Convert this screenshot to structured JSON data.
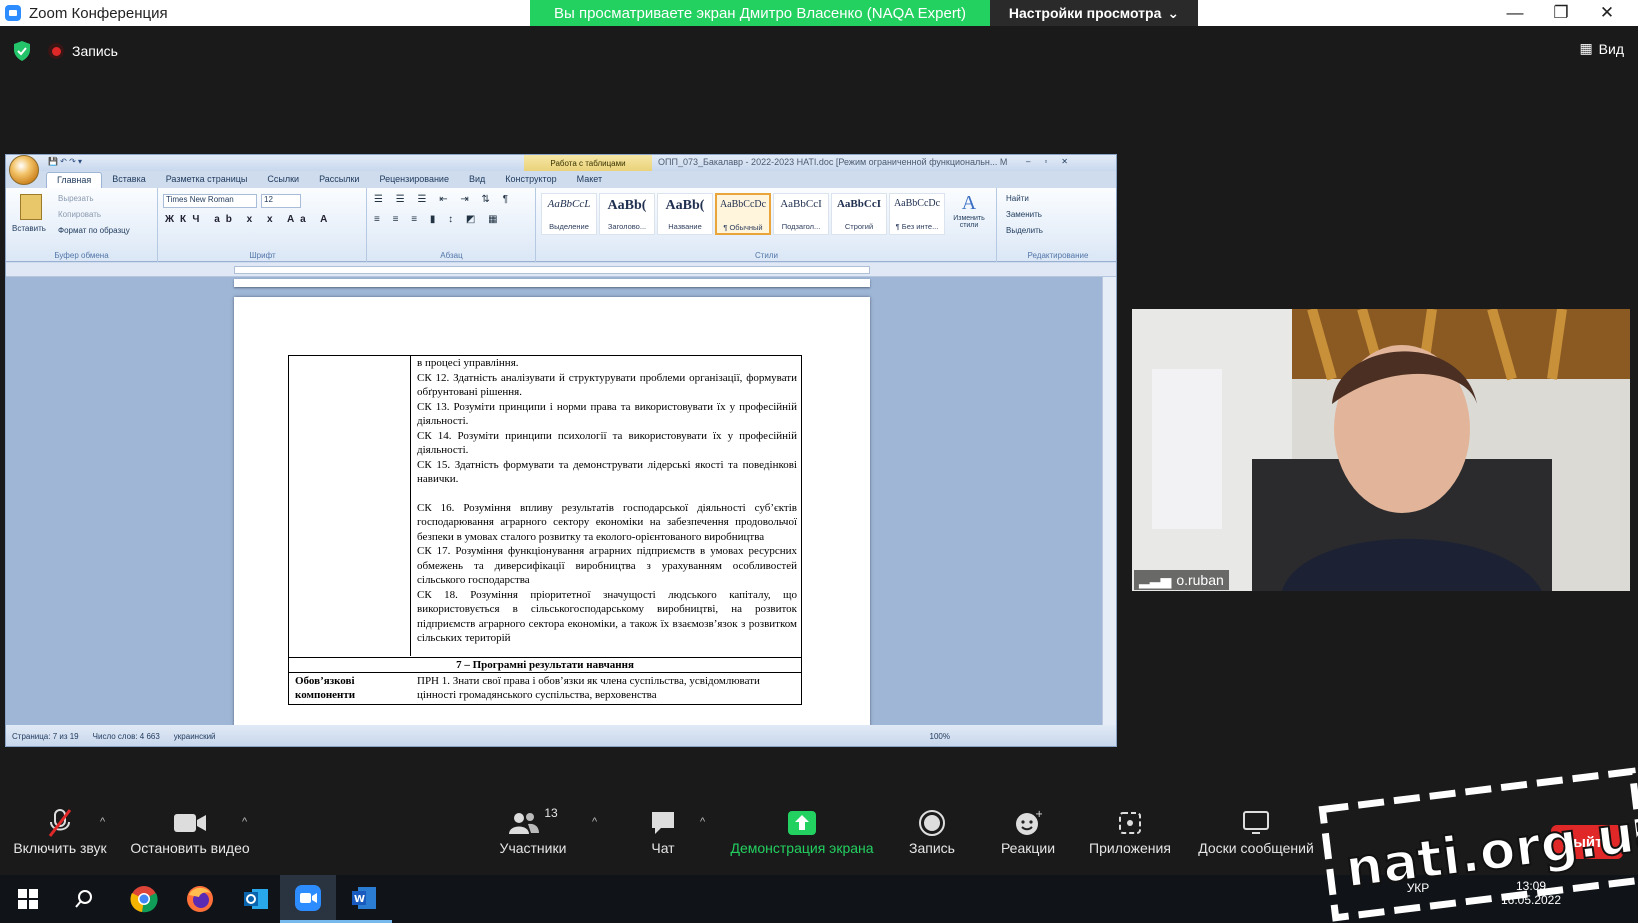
{
  "titlebar": {
    "title": "Zoom Конференция"
  },
  "share_banner": {
    "text": "Вы просматриваете экран Дмитро Власенко (NAQA Expert)"
  },
  "view_settings": {
    "label": "Настройки просмотра"
  },
  "recording": {
    "label": "Запись"
  },
  "view_button": {
    "label": "Вид"
  },
  "word": {
    "table_tools": "Работа с таблицами",
    "doc_title": "ОПП_073_Бакалавр - 2022-2023 НАТІ.doc [Режим ограниченной функциональн... М",
    "tabs": [
      "Главная",
      "Вставка",
      "Разметка страницы",
      "Ссылки",
      "Рассылки",
      "Рецензирование",
      "Вид",
      "Конструктор",
      "Макет"
    ],
    "clipboard": {
      "paste": "Вставить",
      "cut": "Вырезать",
      "copy": "Копировать",
      "format": "Формат по образцу",
      "label": "Буфер обмена"
    },
    "font": {
      "name": "Times New Roman",
      "size": "12",
      "label": "Шрифт"
    },
    "paragraph_label": "Абзац",
    "styles": [
      {
        "sample": "AaBbCcL",
        "name": "Выделение"
      },
      {
        "sample": "AaBb(",
        "name": "Заголово..."
      },
      {
        "sample": "AaBb(",
        "name": "Название"
      },
      {
        "sample": "AaBbCcDc",
        "name": "¶ Обычный"
      },
      {
        "sample": "AaBbCcI",
        "name": "Подзагол..."
      },
      {
        "sample": "AaBbCcI",
        "name": "Строгий"
      },
      {
        "sample": "AaBbCcDc",
        "name": "¶ Без инте..."
      }
    ],
    "styles_label": "Стили",
    "change_styles": "Изменить стили",
    "editing": {
      "find": "Найти",
      "replace": "Заменить",
      "select": "Выделить",
      "label": "Редактирование"
    },
    "doc_lines": [
      "в процесі управління.",
      "СК 12. Здатність аналізувати й структурувати проблеми організації, формувати обґрунтовані рішення.",
      "СК 13. Розуміти принципи і норми права та використовувати їх у професійній діяльності.",
      "СК 14. Розуміти принципи психології та використовувати їх у професійній діяльності.",
      "СК 15. Здатність формувати та демонструвати лідерські якості та поведінкові навички.",
      "СК 16. Розуміння впливу результатів господарської діяльності суб’єктів господарювання аграрного сектору економіки на забезпечення продовольчої безпеки в умовах сталого розвитку та еколого-орієнтованого виробництва",
      "СК 17. Розуміння функціонування аграрних підприємств в умовах ресурсних обмежень та диверсифікації виробництва з урахуванням особливостей сільського господарства",
      "СК 18. Розуміння пріоритетної значущості людського капіталу, що використовується в сільськогосподарському виробництві, на розвиток підприємств аграрного сектора економіки, а також їх взаємозв’язок з розвитком сільських територій"
    ],
    "section_heading": "7 – Програмні результати навчання",
    "oblig_label": "Обов’язкові компоненти",
    "prn_text": "ПРН 1. Знати свої права і обов’язки як члена суспільства, усвідомлювати цінності громадянського суспільства, верховенства",
    "status": {
      "page": "Страница: 7 из 19",
      "words": "Число слов: 4 663",
      "lang": "украинский",
      "zoom": "100%"
    }
  },
  "video": {
    "name": "o.ruban"
  },
  "toolbar": {
    "unmute": "Включить звук",
    "stop_video": "Остановить видео",
    "participants": "Участники",
    "participants_count": "13",
    "chat": "Чат",
    "share": "Демонстрация экрана",
    "record": "Запись",
    "reactions": "Реакции",
    "apps": "Приложения",
    "boards": "Доски сообщений",
    "leave": "Выйти"
  },
  "taskbar": {
    "lang": "УКР",
    "time": "13:09",
    "date": "16.05.2022"
  },
  "watermark": {
    "text": "nati.org.ua"
  },
  "colors": {
    "share_green": "#23d160",
    "leave_red": "#e02828",
    "zoom_blue": "#2d8cff"
  }
}
